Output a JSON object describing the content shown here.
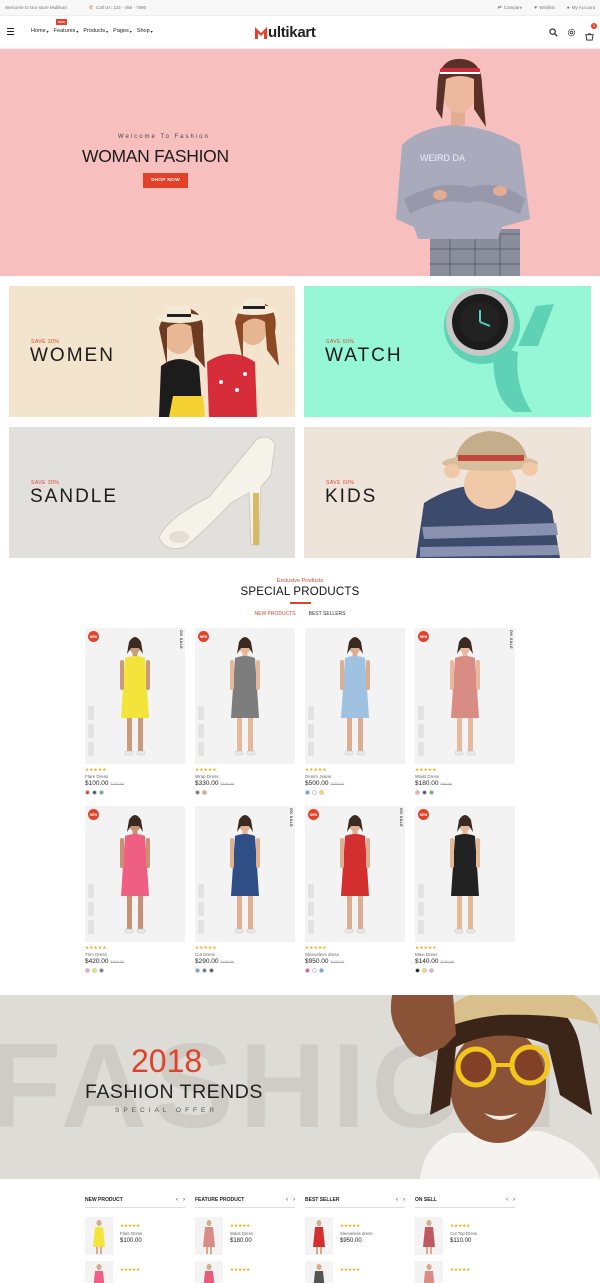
{
  "topbar": {
    "welcome": "Welcome to Our store Multikart",
    "call": "Call Us: 123 - 456 - 7890",
    "compare": "Compare",
    "wishlist": "Wishlist",
    "account": "My Account"
  },
  "header": {
    "nav": [
      "Home",
      "Features",
      "Products",
      "Pages",
      "Shop"
    ],
    "new_badge": "new",
    "logo_initial": "M",
    "logo_text": "ultikart",
    "cart_count": "0"
  },
  "hero": {
    "welcome": "Welcome To Fashion",
    "title": "WOMAN FASHION",
    "button": "SHOP NOW"
  },
  "banners": [
    {
      "save": "SAVE 30%",
      "title": "WOMEN",
      "bg": "#f3e4cd"
    },
    {
      "save": "SAVE 60%",
      "title": "WATCH",
      "bg": "#95f7d5"
    },
    {
      "save": "SAVE 30%",
      "title": "SANDLE",
      "bg": "#e2e0dc"
    },
    {
      "save": "SAVE 60%",
      "title": "KIDS",
      "bg": "#efe4da"
    }
  ],
  "section": {
    "exclusive": "Exclusive Products",
    "title": "SPECIAL PRODUCTS",
    "tab_new": "NEW PRODUCTS",
    "tab_best": "BEST SELLERS"
  },
  "product_labels": {
    "new": "NEW",
    "sale": "ON SALE",
    "stars": "★★★★★"
  },
  "products": [
    {
      "name": "Flare Dress",
      "price": "$100.00",
      "old": "$200.00",
      "new": true,
      "sale": true,
      "dress": "#f2e43a",
      "skin": "#c99b7a",
      "colors": [
        "#e4412a",
        "#555555",
        "#5cb85c"
      ]
    },
    {
      "name": "Wrap Dress",
      "price": "$330.00",
      "old": "$165.00",
      "new": true,
      "sale": false,
      "dress": "#7d7d7d",
      "skin": "#e5b89a",
      "colors": [
        "#777777",
        "#f39a5b"
      ]
    },
    {
      "name": "Denim Jeans",
      "price": "$500.00",
      "old": "$250.00",
      "new": false,
      "sale": false,
      "dress": "#9ec2e0",
      "skin": "#dcae8f",
      "colors": [
        "#5aa6e6",
        "#ffffff",
        "#f2e43a"
      ]
    },
    {
      "name": "Waist Dress",
      "price": "$180.00",
      "old": "$90.00",
      "new": true,
      "sale": true,
      "dress": "#d88c83",
      "skin": "#e8b99c",
      "colors": [
        "#f6a3b8",
        "#555555",
        "#5cb85c"
      ]
    },
    {
      "name": "Trim Dress",
      "price": "$420.00",
      "old": "$840.00",
      "new": true,
      "sale": false,
      "dress": "#ef5f83",
      "skin": "#c99071",
      "colors": [
        "#f6a3b8",
        "#f2e43a",
        "#777777"
      ]
    },
    {
      "name": "Cut Dress",
      "price": "$290.00",
      "old": "$480.00",
      "new": false,
      "sale": true,
      "dress": "#2f4e86",
      "skin": "#e0b090",
      "colors": [
        "#5aa6e6",
        "#777777",
        "#555555"
      ]
    },
    {
      "name": "Sleeveless dress",
      "price": "$950.00",
      "old": "$475.00",
      "new": true,
      "sale": true,
      "dress": "#d32f2f",
      "skin": "#dcae8f",
      "colors": [
        "#e75a7c",
        "#ffffff",
        "#5aa6e6"
      ]
    },
    {
      "name": "Maxi Dress",
      "price": "$140.00",
      "old": "$280.00",
      "new": true,
      "sale": false,
      "dress": "#222222",
      "skin": "#e6b896",
      "colors": [
        "#111111",
        "#f2e43a",
        "#f6a3b8"
      ]
    }
  ],
  "parallax": {
    "bgword": "FASHION",
    "year": "2018",
    "title": "FASHION TRENDS",
    "offer": "SPECIAL OFFER"
  },
  "bottom_lists": [
    {
      "label": "NEW PRODUCT",
      "item": {
        "name": "Flare Dress",
        "price": "$100.00",
        "dress": "#f2e43a"
      },
      "next_dress": "#ef5f83"
    },
    {
      "label": "FEATURE PRODUCT",
      "item": {
        "name": "Waist Dress",
        "price": "$180.00",
        "dress": "#d88c83"
      },
      "next_dress": "#e75a7c"
    },
    {
      "label": "BEST SELLER",
      "item": {
        "name": "Sleeveless dress",
        "price": "$950.00",
        "dress": "#d32f2f"
      },
      "next_dress": "#555555"
    },
    {
      "label": "ON SELL",
      "item": {
        "name": "Cut Top Dress",
        "price": "$110.00",
        "dress": "#c0595f"
      },
      "next_dress": "#d88c83"
    }
  ],
  "bottom_arrows": {
    "prev": "‹",
    "next": "›"
  },
  "colors": {
    "accent": "#e4412a",
    "hero_bg": "#f7c0bf",
    "star": "#ffa200"
  }
}
